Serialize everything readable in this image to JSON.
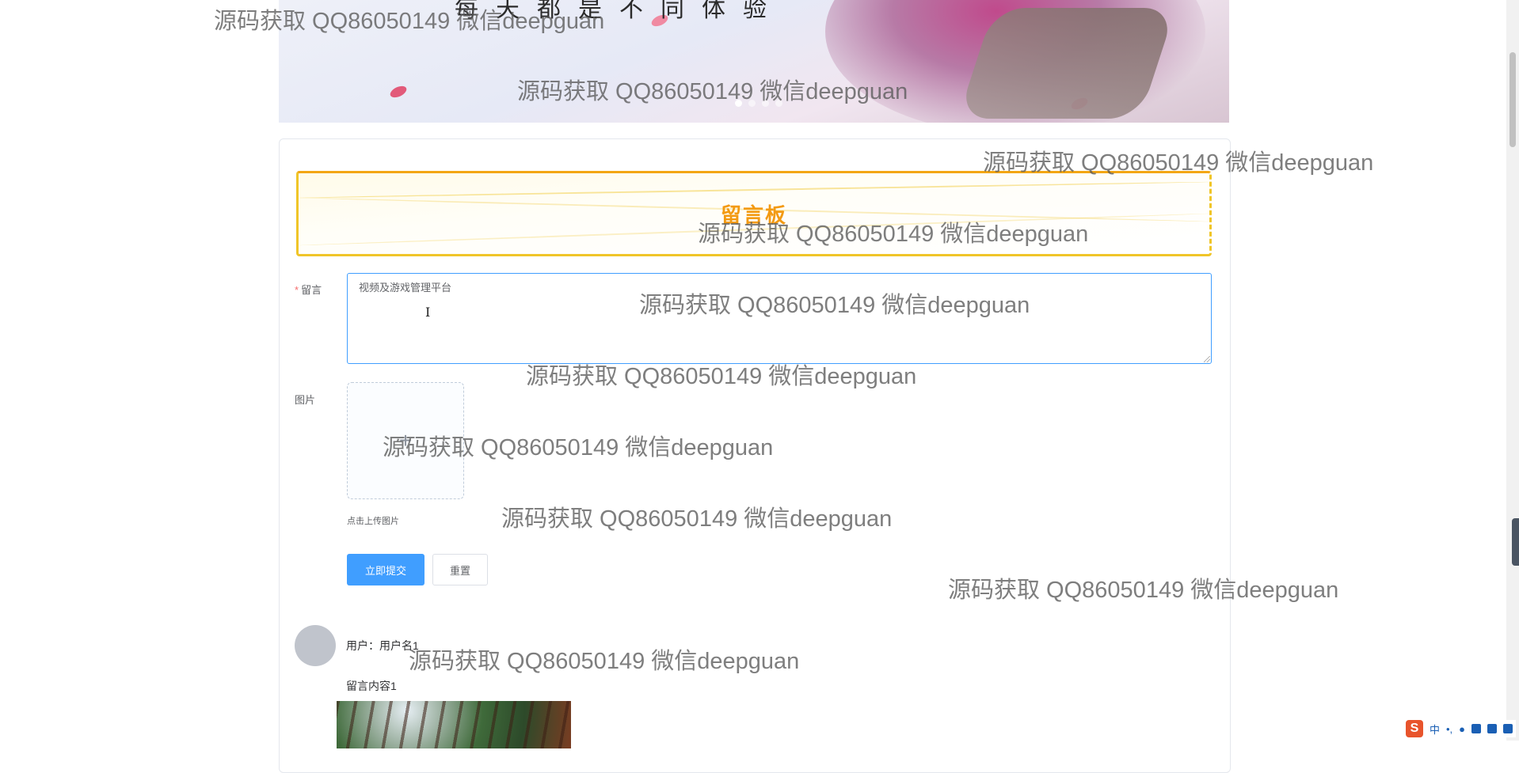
{
  "banner": {
    "slogan": "每天都是不同体验",
    "carousel_count": 4
  },
  "board": {
    "title": "留言板"
  },
  "form": {
    "message_label": "留言",
    "required_mark": "*",
    "message_value": "视频及游戏管理平台",
    "image_label": "图片",
    "upload_tip": "点击上传图片",
    "submit_label": "立即提交",
    "reset_label": "重置"
  },
  "comments": [
    {
      "user": "用户：用户名1",
      "content": "留言内容1"
    }
  ],
  "watermark": "源码获取 QQ86050149 微信deepguan",
  "ime": {
    "logo": "S",
    "lang": "中"
  },
  "colors": {
    "primary": "#409eff",
    "board_accent": "#f39a12",
    "board_border": "#f0c528",
    "required": "#f56c6c"
  }
}
